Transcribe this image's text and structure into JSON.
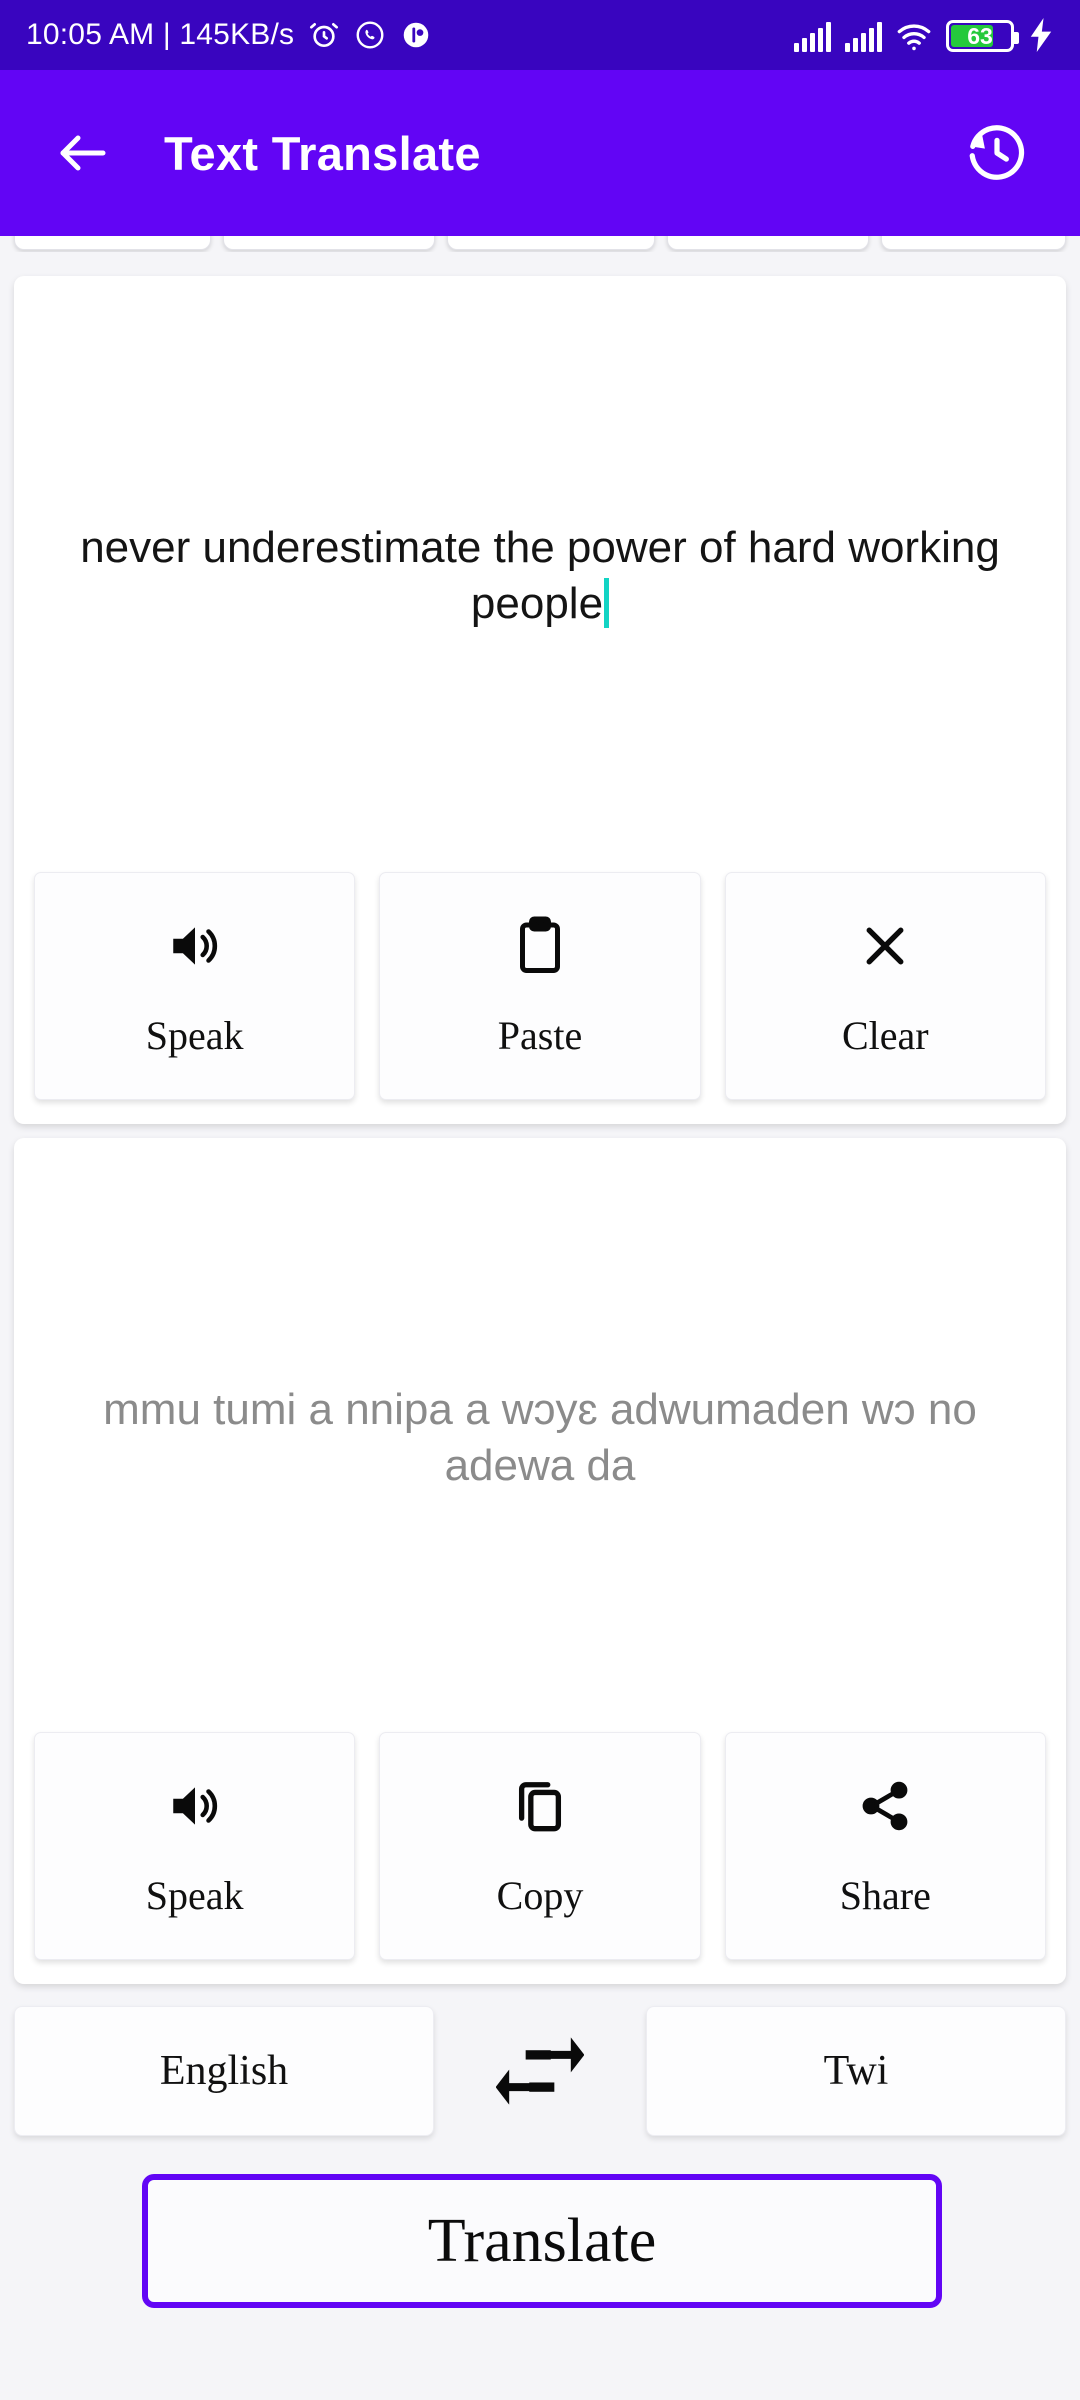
{
  "status_bar": {
    "time_and_network": "10:05 AM | 145KB/s",
    "icons": [
      "alarm-icon",
      "whatsapp-icon",
      "app-notification-icon",
      "signal-bars-sim1-icon",
      "signal-bars-sim2-icon",
      "wifi-icon"
    ],
    "battery_percent": "63",
    "charging": true,
    "background_color": "#3905bf"
  },
  "app_bar": {
    "back_icon": "back-arrow-icon",
    "title": "Text Translate",
    "history_icon": "history-clock-icon",
    "background_color": "#6205f5"
  },
  "input_card": {
    "text": "never underestimate the power of hard working people",
    "caret_color": "#12d4c4",
    "actions": [
      {
        "label": "Speak",
        "icon": "volume-up-icon"
      },
      {
        "label": "Paste",
        "icon": "clipboard-icon"
      },
      {
        "label": "Clear",
        "icon": "close-x-icon"
      }
    ]
  },
  "output_card": {
    "text": "mmu tumi a nnipa a wɔyɛ adwumaden wɔ no adewa da",
    "text_color": "#8b8b8b",
    "actions": [
      {
        "label": "Speak",
        "icon": "volume-up-icon"
      },
      {
        "label": "Copy",
        "icon": "copy-icon"
      },
      {
        "label": "Share",
        "icon": "share-icon"
      }
    ]
  },
  "language_row": {
    "source_language": "English",
    "swap_icon": "swap-arrows-icon",
    "target_language": "Twi"
  },
  "translate_button": {
    "label": "Translate",
    "border_color": "#6205f5"
  }
}
